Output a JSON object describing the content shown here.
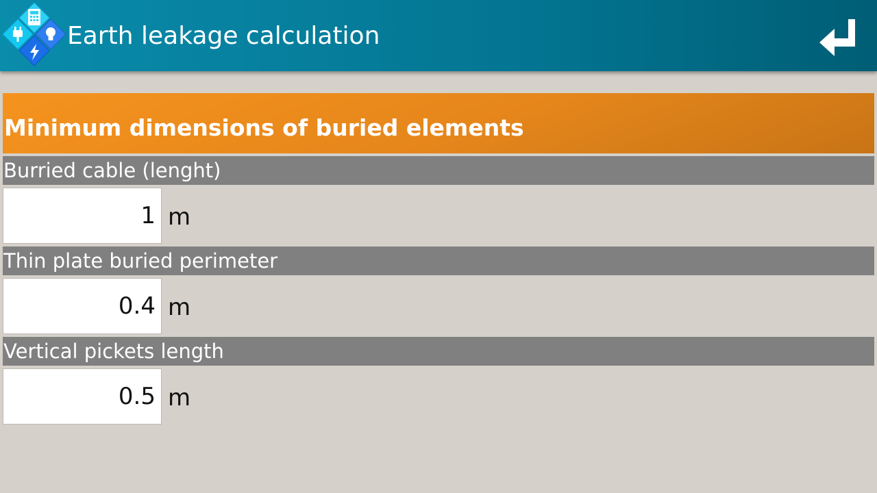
{
  "header": {
    "title": "Earth leakage calculation",
    "app_icon": "calculator-plug-bulb-bolt-icon",
    "back_icon": "return-arrow-icon"
  },
  "section": {
    "title": "Minimum dimensions of buried elements"
  },
  "fields": [
    {
      "label": "Burried cable (lenght)",
      "value": "1",
      "unit": "m"
    },
    {
      "label": "Thin plate buried perimeter",
      "value": "0.4",
      "unit": "m"
    },
    {
      "label": "Vertical pickets length",
      "value": "0.5",
      "unit": "m"
    }
  ],
  "colors": {
    "appbar": "#037592",
    "section_header": "#f5931e",
    "label_bar": "#808080",
    "background": "#d5d0c9"
  }
}
